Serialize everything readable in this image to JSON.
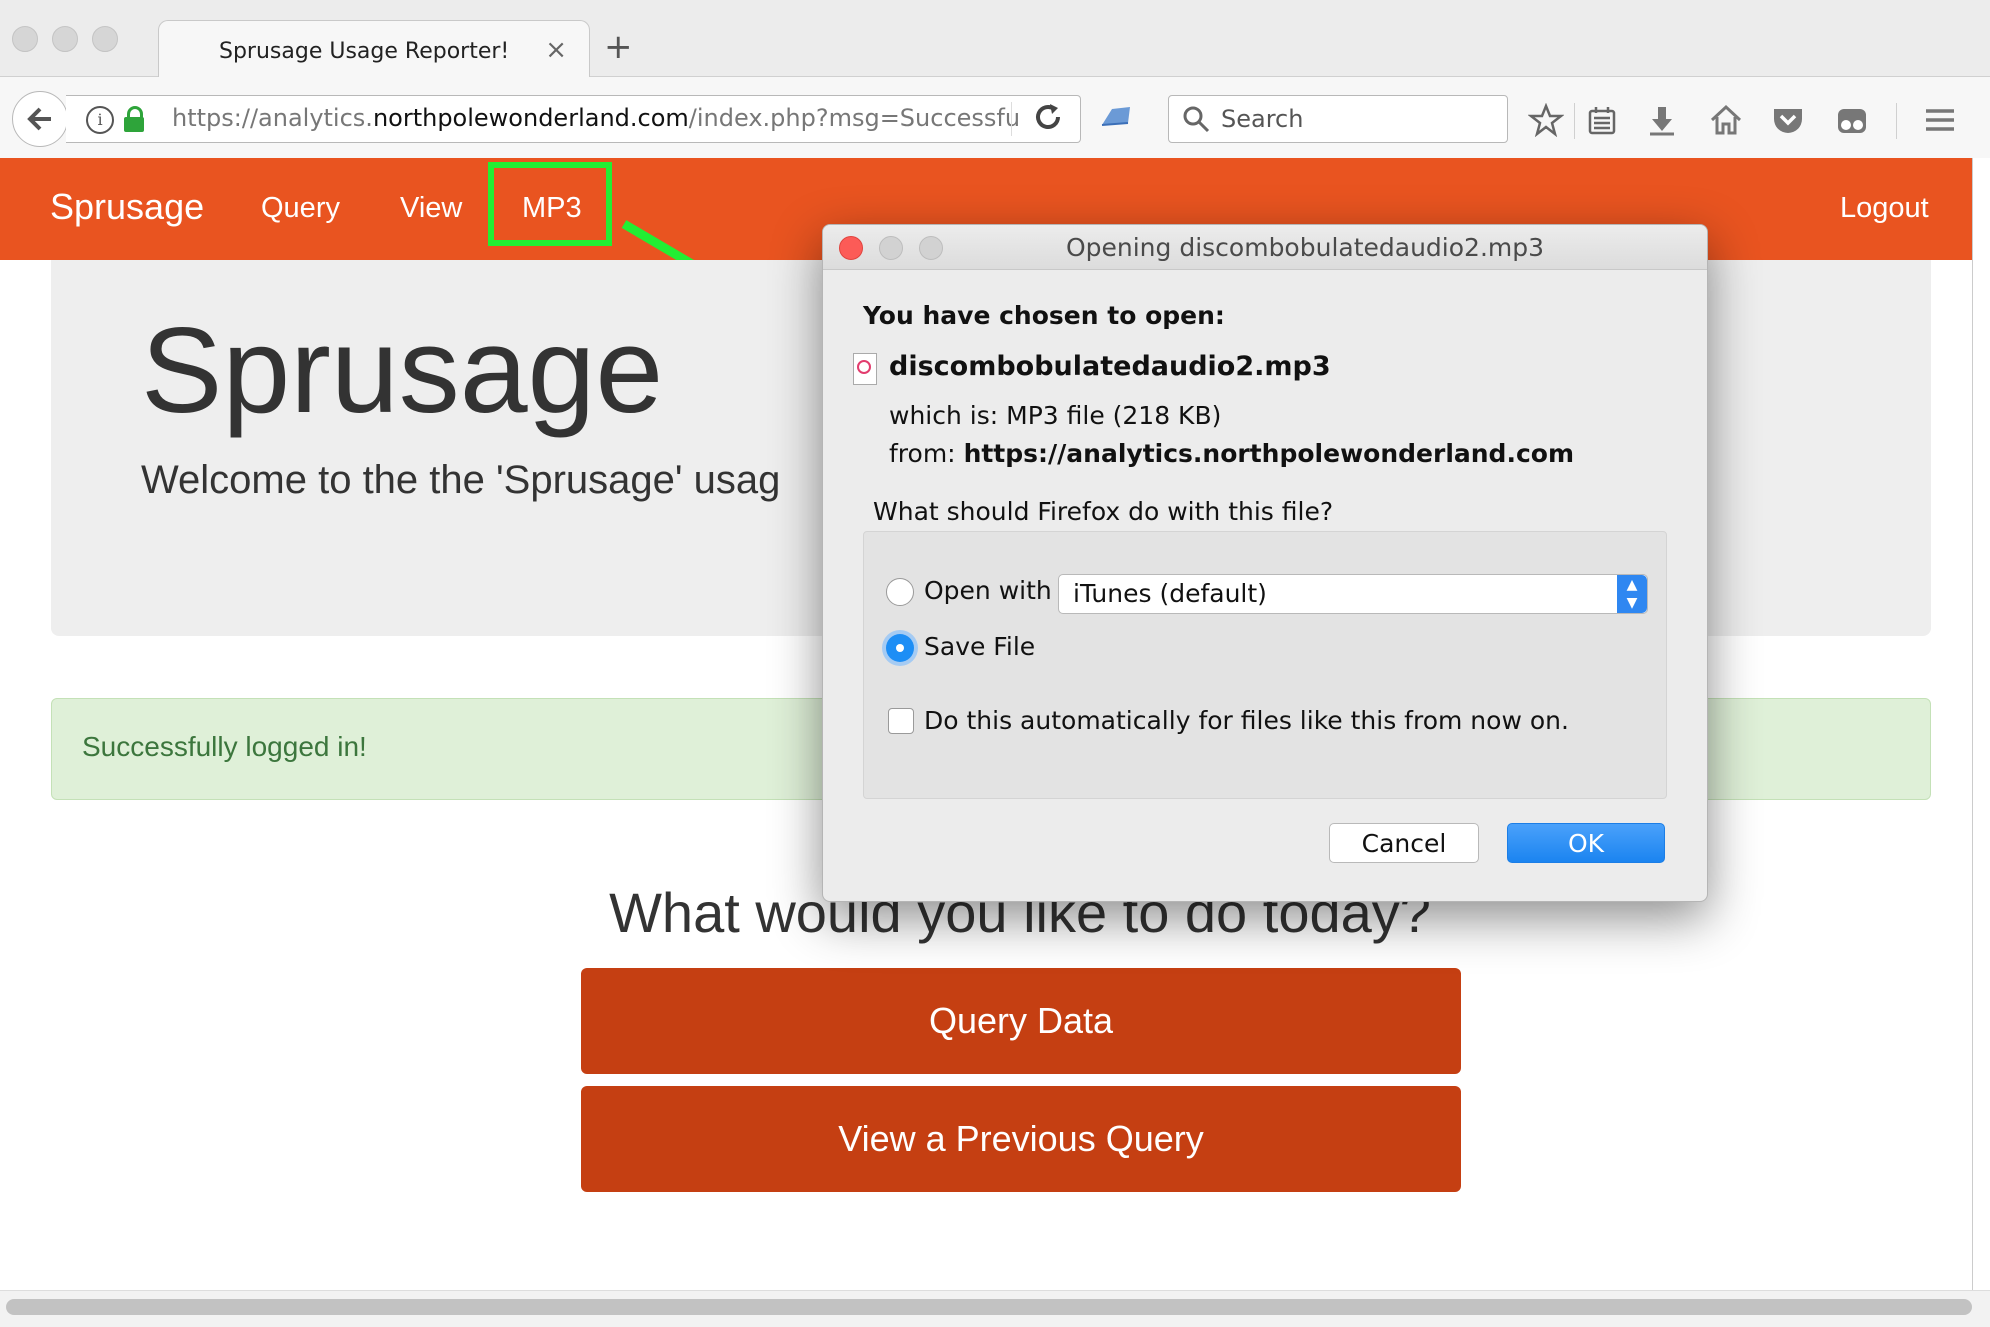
{
  "browser": {
    "tab_title": "Sprusage Usage Reporter!",
    "tab_close_glyph": "×",
    "new_tab_glyph": "+",
    "url_prefix": "https://analytics.",
    "url_domain": "northpolewonderland.com",
    "url_path": "/index.php?msg=Successfu",
    "search_placeholder": "Search"
  },
  "site_nav": {
    "brand": "Sprusage",
    "links": [
      "Query",
      "View",
      "MP3"
    ],
    "logout": "Logout",
    "highlight_color": "#22ee33",
    "bar_color": "#e95420"
  },
  "jumbotron": {
    "title": "Sprusage",
    "subtitle": "Welcome to the the 'Sprusage' usag"
  },
  "alert": {
    "text": "Successfully logged in!"
  },
  "main": {
    "question": "What would you like to do today?",
    "buttons": [
      "Query Data",
      "View a Previous Query"
    ],
    "button_color": "#c53f12"
  },
  "dialog": {
    "title": "Opening discombobulatedaudio2.mp3",
    "heading": "You have chosen to open:",
    "file_name": "discombobulatedaudio2.mp3",
    "which_is_label": "which is:",
    "which_is_value": "MP3 file (218 KB)",
    "from_label": "from:",
    "from_value": "https://analytics.northpolewonderland.com",
    "question": "What should Firefox do with this file?",
    "open_with_label": "Open with",
    "open_with_app": "iTunes (default)",
    "save_file_label": "Save File",
    "save_file_selected": true,
    "auto_label": "Do this automatically for files like this from now on.",
    "auto_checked": false,
    "cancel_label": "Cancel",
    "ok_label": "OK"
  }
}
